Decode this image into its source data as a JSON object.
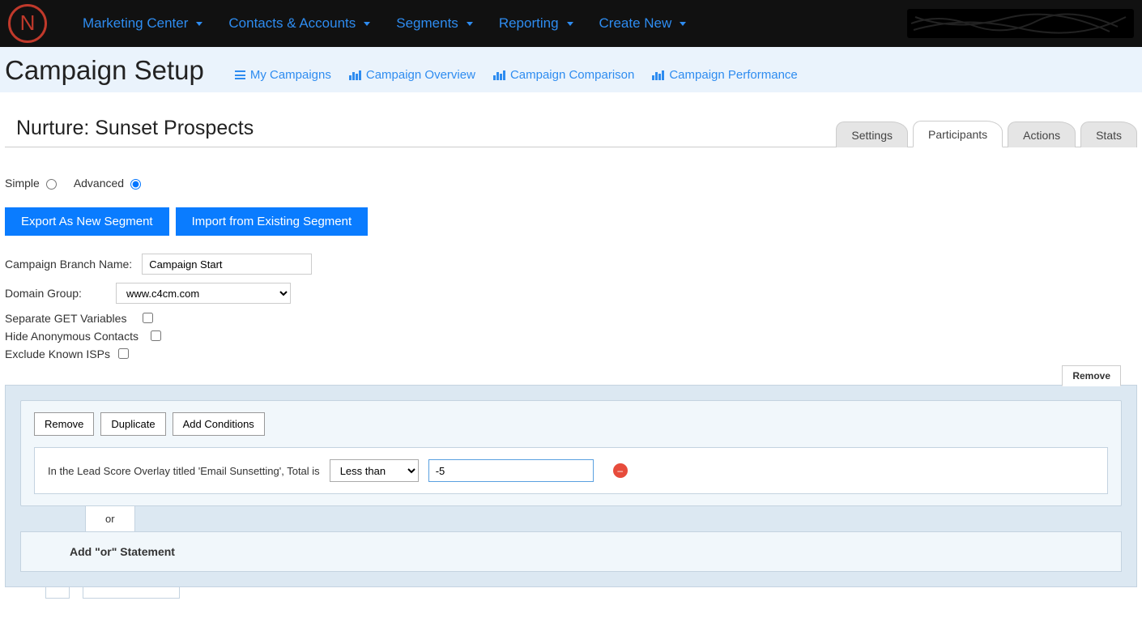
{
  "nav": {
    "items": [
      "Marketing Center",
      "Contacts & Accounts",
      "Segments",
      "Reporting",
      "Create New"
    ]
  },
  "logo_letter": "N",
  "header": {
    "title": "Campaign Setup",
    "links": [
      "My Campaigns",
      "Campaign Overview",
      "Campaign Comparison",
      "Campaign Performance"
    ]
  },
  "campaign": {
    "title": "Nurture: Sunset Prospects",
    "tabs": [
      "Settings",
      "Participants",
      "Actions",
      "Stats"
    ],
    "active_tab": "Participants"
  },
  "mode": {
    "simple": "Simple",
    "advanced": "Advanced",
    "selected": "Advanced"
  },
  "buttons": {
    "export": "Export As New Segment",
    "import": "Import from Existing Segment"
  },
  "form": {
    "branch_label": "Campaign Branch Name:",
    "branch_value": "Campaign Start",
    "domain_label": "Domain Group:",
    "domain_value": "www.c4cm.com",
    "sep_get": "Separate GET Variables",
    "hide_anon": "Hide Anonymous Contacts",
    "exclude_isp": "Exclude Known ISPs"
  },
  "rule": {
    "remove_tab": "Remove",
    "remove": "Remove",
    "duplicate": "Duplicate",
    "add_conditions": "Add Conditions",
    "condition_text": "In the Lead Score Overlay titled 'Email Sunsetting', Total is",
    "operator": "Less than",
    "value": "-5",
    "or_label": "or",
    "add_or": "Add \"or\" Statement"
  }
}
